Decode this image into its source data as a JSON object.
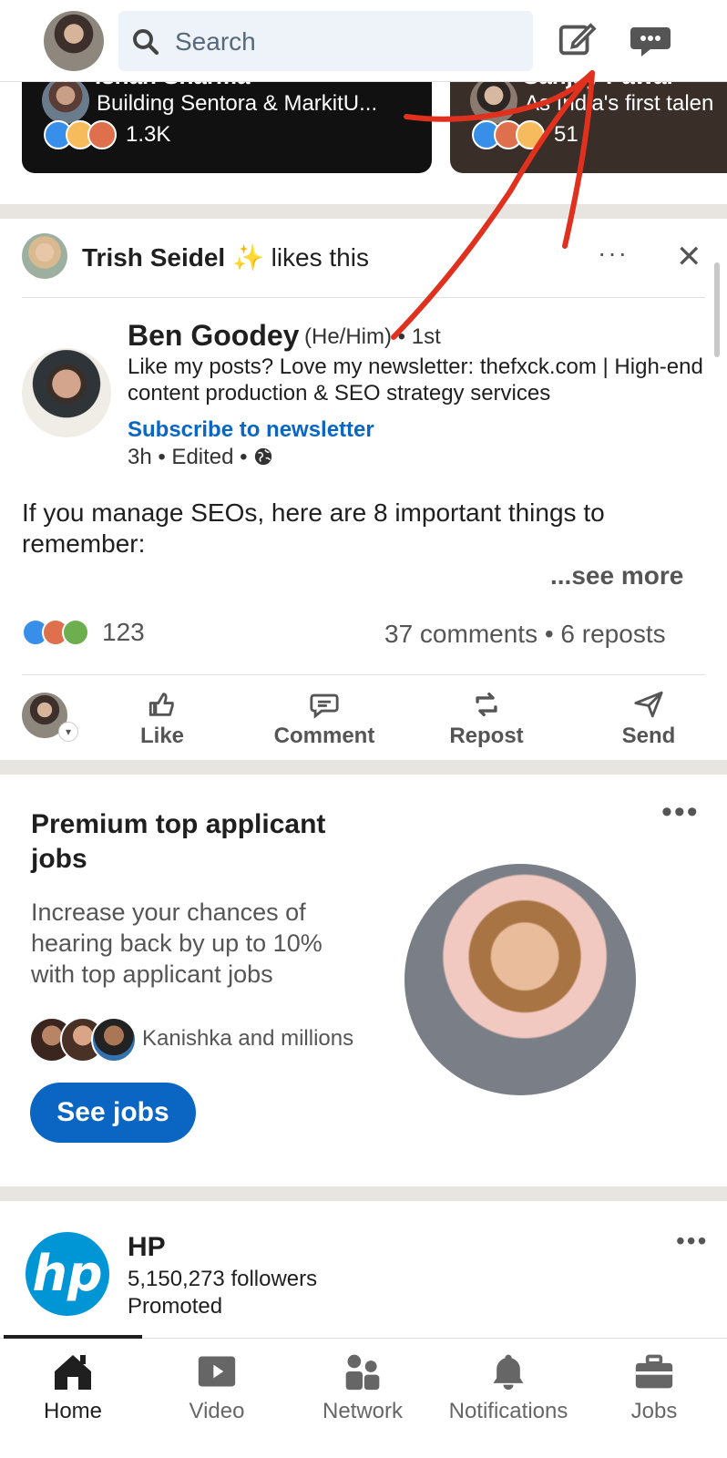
{
  "header": {
    "search_placeholder": "Search",
    "compose_icon": "compose-icon",
    "messaging_icon": "messaging-icon"
  },
  "story_cards": [
    {
      "name": "Ishan Sharma",
      "headline": "Building Sentora & MarkitU...",
      "reaction_count": "1.3K"
    },
    {
      "name": "Sanjay Pawar",
      "headline": "As India's first talen",
      "reaction_count": "51"
    }
  ],
  "post": {
    "context_user": "Trish Seidel",
    "context_sparkle": "✨",
    "context_action": "likes this",
    "more_label": "···",
    "close_label": "✕",
    "author_name": "Ben Goodey",
    "author_pronouns": "(He/Him)",
    "author_degree": "• 1st",
    "author_headline": "Like my posts? Love my newsletter: thefxck.com | High-end content production & SEO strategy services",
    "subscribe_label": "Subscribe to newsletter",
    "time": "3h • Edited •",
    "text": "If you manage SEOs, here are 8 important things to remember:",
    "see_more": "...see more",
    "reaction_count": "123",
    "comments_reposts": "37 comments  •  6 reposts",
    "actions": {
      "like": "Like",
      "comment": "Comment",
      "repost": "Repost",
      "send": "Send"
    }
  },
  "premium": {
    "title": "Premium top applicant jobs",
    "description": "Increase your chances of hearing back by up to 10% with top applicant jobs",
    "social_proof": "Kanishka and millions",
    "cta": "See jobs",
    "more_label": "•••"
  },
  "promoted": {
    "logo_text": "hp",
    "name": "HP",
    "followers": "5,150,273 followers",
    "label": "Promoted",
    "more_label": "•••"
  },
  "nav": [
    {
      "label": "Home",
      "icon": "home-icon",
      "active": true
    },
    {
      "label": "Video",
      "icon": "video-icon"
    },
    {
      "label": "Network",
      "icon": "network-icon"
    },
    {
      "label": "Notifications",
      "icon": "bell-icon"
    },
    {
      "label": "Jobs",
      "icon": "briefcase-icon"
    }
  ],
  "colors": {
    "accent": "#0a66c2",
    "annotation": "#e0301e",
    "separator": "#e8e4df"
  }
}
